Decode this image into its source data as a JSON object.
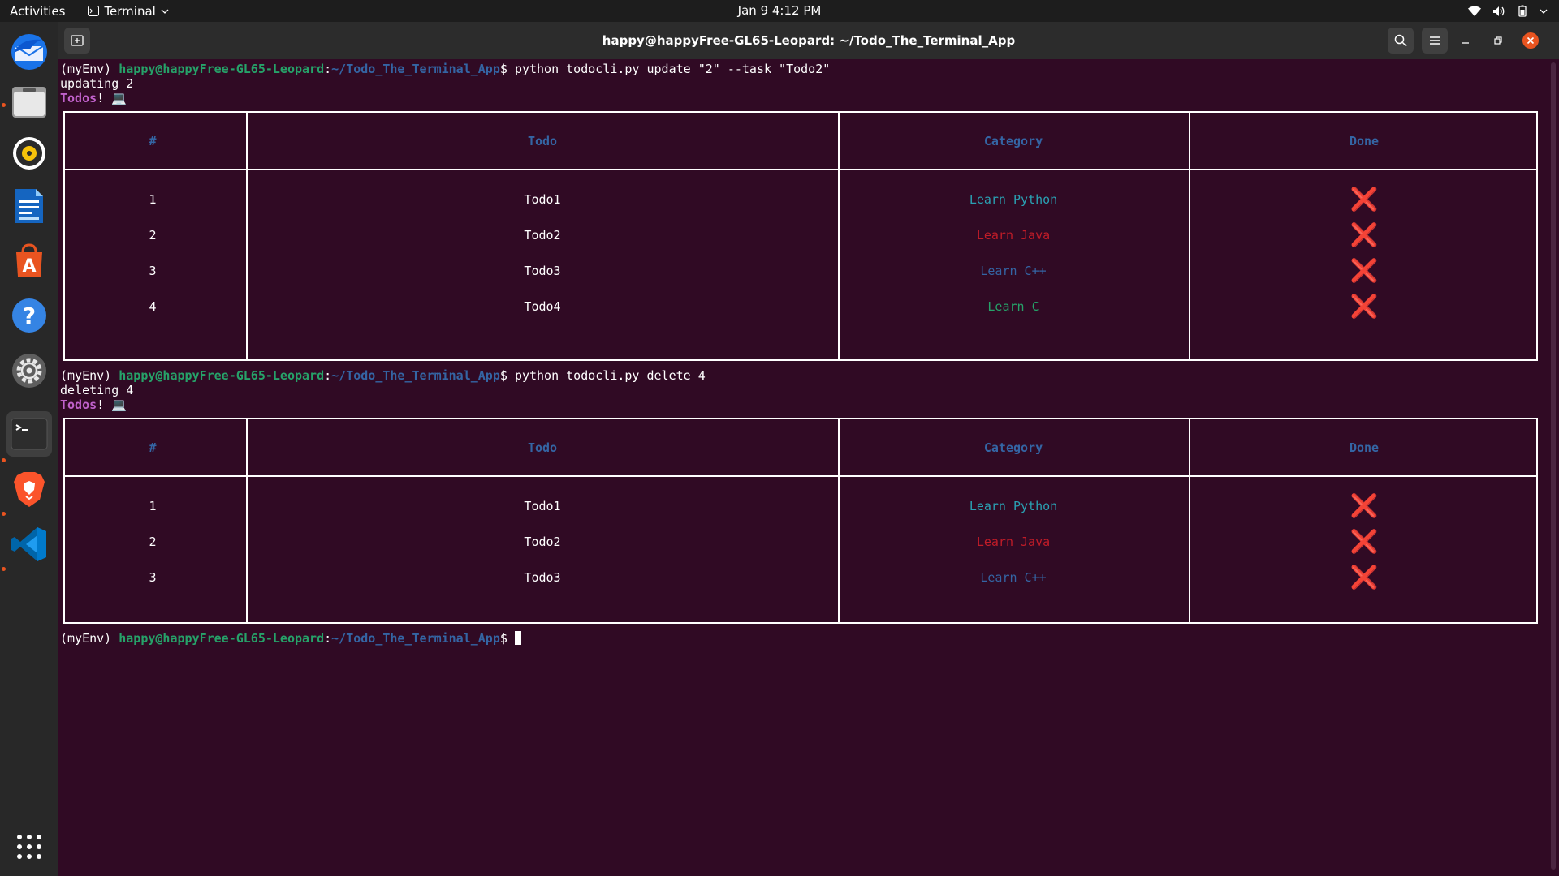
{
  "topbar": {
    "activities": "Activities",
    "app_name": "Terminal",
    "clock": "Jan 9  4:12 PM"
  },
  "dock": {
    "items": [
      "thunderbird-mail",
      "files",
      "rhythmbox",
      "libreoffice-writer",
      "ubuntu-software",
      "help",
      "settings",
      "terminal",
      "brave-browser",
      "vs-code"
    ],
    "show_apps": "show-applications"
  },
  "window": {
    "title": "happy@happyFree-GL65-Leopard: ~/Todo_The_Terminal_App"
  },
  "terminal": {
    "prompt_env": "(myEnv) ",
    "prompt_user": "happy@happyFree-GL65-Leopard",
    "prompt_colon": ":",
    "prompt_path": "~/Todo_The_Terminal_App",
    "prompt_dollar": "$ ",
    "command1": "python todocli.py update \"2\" --task \"Todo2\"",
    "output1": "updating 2",
    "todos_label": "Todos",
    "todos_suffix": "! 💻",
    "command2": "python todocli.py delete 4",
    "output2": "deleting 4",
    "table_headers": [
      "#",
      "Todo",
      "Category",
      "Done"
    ],
    "done_symbol": "❌",
    "table1_rows": [
      {
        "num": "1",
        "todo": "Todo1",
        "category": "Learn Python"
      },
      {
        "num": "2",
        "todo": "Todo2",
        "category": "Learn Java"
      },
      {
        "num": "3",
        "todo": "Todo3",
        "category": "Learn C++"
      },
      {
        "num": "4",
        "todo": "Todo4",
        "category": "Learn C"
      }
    ],
    "table2_rows": [
      {
        "num": "1",
        "todo": "Todo1",
        "category": "Learn Python"
      },
      {
        "num": "2",
        "todo": "Todo2",
        "category": "Learn Java"
      },
      {
        "num": "3",
        "todo": "Todo3",
        "category": "Learn C++"
      }
    ]
  },
  "colors": {
    "terminal_bg": "#300a24",
    "prompt_user": "#26a269",
    "prompt_path": "#3465a4",
    "category_python": "#2aa1b3",
    "category_java": "#c01c28",
    "category_cpp": "#3465a4",
    "category_c": "#26a269",
    "done_false": "#e01b24"
  }
}
